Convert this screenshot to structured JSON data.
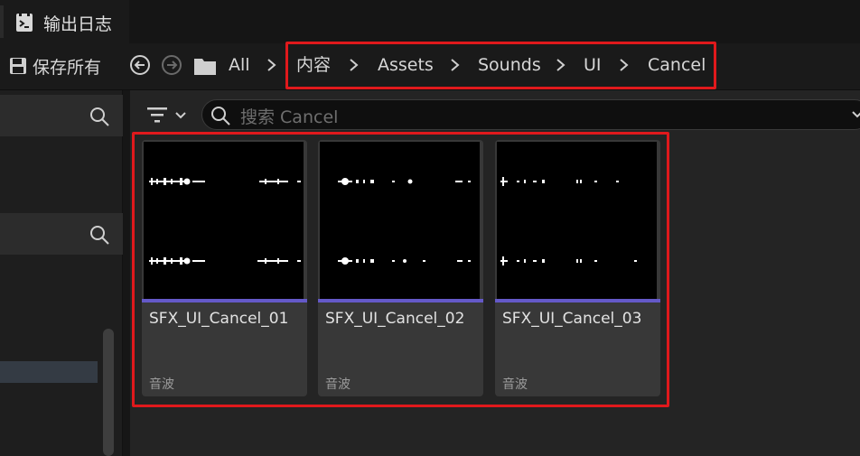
{
  "window": {
    "title": "输出日志"
  },
  "toolbar": {
    "save_label": "保存所有",
    "breadcrumbs": [
      "All",
      "内容",
      "Assets",
      "Sounds",
      "UI",
      "Cancel"
    ]
  },
  "search": {
    "placeholder": "搜索 Cancel"
  },
  "assets": [
    {
      "name": "SFX_UI_Cancel_01",
      "type": "音波"
    },
    {
      "name": "SFX_UI_Cancel_02",
      "type": "音波"
    },
    {
      "name": "SFX_UI_Cancel_03",
      "type": "音波"
    }
  ],
  "colors": {
    "highlight": "#e0191c",
    "asset_type_bar": "#6459c8"
  }
}
